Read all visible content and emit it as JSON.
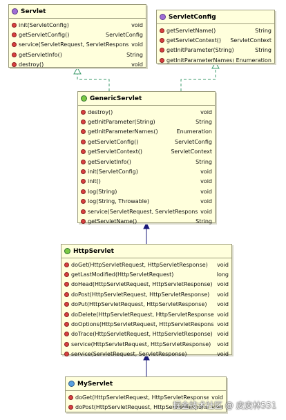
{
  "classes": {
    "servlet": {
      "name": "Servlet",
      "kind": "interface",
      "methods": [
        {
          "name": "init(ServletConfig)",
          "type": "void"
        },
        {
          "name": "getServletConfig()",
          "type": "ServletConfig"
        },
        {
          "name": "service(ServletRequest, ServletResponse)",
          "type": "void"
        },
        {
          "name": "getServletInfo()",
          "type": "String"
        },
        {
          "name": "destroy()",
          "type": "void"
        }
      ]
    },
    "servlet_config": {
      "name": "ServletConfig",
      "kind": "interface",
      "methods": [
        {
          "name": "getServletName()",
          "type": "String"
        },
        {
          "name": "getServletContext()",
          "type": "ServletContext"
        },
        {
          "name": "getInitParameter(String)",
          "type": "String"
        },
        {
          "name": "getInitParameterNames()",
          "type": "Enumeration"
        }
      ]
    },
    "generic_servlet": {
      "name": "GenericServlet",
      "kind": "class",
      "methods": [
        {
          "name": "destroy()",
          "type": "void"
        },
        {
          "name": "getInitParameter(String)",
          "type": "String"
        },
        {
          "name": "getInitParameterNames()",
          "type": "Enumeration"
        },
        {
          "name": "getServletConfig()",
          "type": "ServletConfig"
        },
        {
          "name": "getServletContext()",
          "type": "ServletContext"
        },
        {
          "name": "getServletInfo()",
          "type": "String"
        },
        {
          "name": "init(ServletConfig)",
          "type": "void"
        },
        {
          "name": "init()",
          "type": "void"
        },
        {
          "name": "log(String)",
          "type": "void"
        },
        {
          "name": "log(String, Throwable)",
          "type": "void"
        },
        {
          "name": "service(ServletRequest, ServletResponse)",
          "type": "void"
        },
        {
          "name": "getServletName()",
          "type": "String"
        }
      ]
    },
    "http_servlet": {
      "name": "HttpServlet",
      "kind": "class",
      "methods": [
        {
          "name": "doGet(HttpServletRequest, HttpServletResponse)",
          "type": "void"
        },
        {
          "name": "getLastModified(HttpServletRequest)",
          "type": "long"
        },
        {
          "name": "doHead(HttpServletRequest, HttpServletResponse)",
          "type": "void"
        },
        {
          "name": "doPost(HttpServletRequest, HttpServletResponse)",
          "type": "void"
        },
        {
          "name": "doPut(HttpServletRequest, HttpServletResponse)",
          "type": "void"
        },
        {
          "name": "doDelete(HttpServletRequest, HttpServletResponse)",
          "type": "void"
        },
        {
          "name": "doOptions(HttpServletRequest, HttpServletResponse)",
          "type": "void"
        },
        {
          "name": "doTrace(HttpServletRequest, HttpServletResponse)",
          "type": "void"
        },
        {
          "name": "service(HttpServletRequest, HttpServletResponse)",
          "type": "void"
        },
        {
          "name": "service(ServletRequest, ServletResponse)",
          "type": "void"
        }
      ]
    },
    "my_servlet": {
      "name": "MyServlet",
      "kind": "class-plain",
      "methods": [
        {
          "name": "doGet(HttpServletRequest, HttpServletResponse)",
          "type": "void"
        },
        {
          "name": "doPost(HttpServletRequest, HttpServletResponse)",
          "type": "void"
        }
      ]
    }
  },
  "watermark": "掘金技术社区 @ 皮皮林551",
  "colors": {
    "box_fill": "#ffffdc",
    "realization_edge": "#3a9a6a",
    "inheritance_edge": "#1a1a7a",
    "method_icon": "#d84040"
  }
}
